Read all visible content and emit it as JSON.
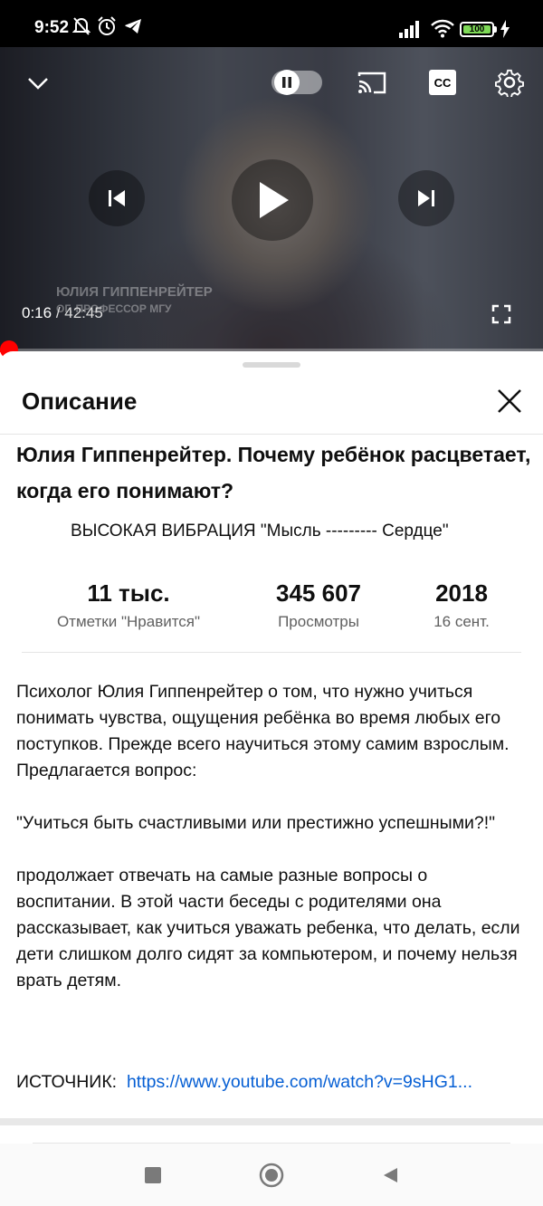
{
  "status_bar": {
    "time": "9:52",
    "battery": "100",
    "icons": [
      "mute-bell-icon",
      "alarm-icon",
      "telegram-icon",
      "signal-icon",
      "wifi-icon",
      "battery-icon",
      "charging-icon"
    ]
  },
  "player": {
    "overlay_name": "ЮЛИЯ ГИППЕНРЕЙТЕР",
    "overlay_subtitle": "ОГ, ПРОФЕССОР МГУ",
    "current_time": "0:16",
    "duration": "/ 42:45",
    "progress": 0.006,
    "controls": [
      "collapse-chevron-icon",
      "autoplay-toggle",
      "cast-icon",
      "captions-icon",
      "settings-gear-icon",
      "previous-icon",
      "play-icon",
      "next-icon",
      "fullscreen-icon"
    ],
    "captions_label": "CC"
  },
  "panel": {
    "title": "Описание",
    "video_title": "Юлия Гиппенрейтер. Почему ребёнок расцветает, когда его понимают?",
    "channel": "ВЫСОКАЯ  ВИБРАЦИЯ   \"Мысль ---------  Сердце\"",
    "stats": [
      {
        "value": "11 тыс.",
        "label": "Отметки \"Нравится\""
      },
      {
        "value": "345 607",
        "label": "Просмотры"
      },
      {
        "value": "2018",
        "label": "16 сент."
      }
    ],
    "description": "Психолог Юлия Гиппенрейтер  о том,  что  нужно учиться понимать чувства, ощущения ребёнка во время любых его поступков. Прежде всего научиться этому самим взрослым.\nПредлагается вопрос:\n\n\"Учиться  быть счастливыми  или престижно успешными?!\"\n\n продолжает отвечать на самые разные вопросы о воспитании. В этой части беседы с родителями она рассказывает, как учиться уважать ребенка, что делать, если дети слишком долго сидят за компьютером, и почему нельзя врать детям.",
    "source_label": "ИСТОЧНИК:",
    "source_url": "https://www.youtube.com/watch?v=9sHG1..."
  },
  "colors": {
    "accent_red": "#ff0000",
    "link_blue": "#065fd4",
    "secondary_text": "#606060"
  }
}
